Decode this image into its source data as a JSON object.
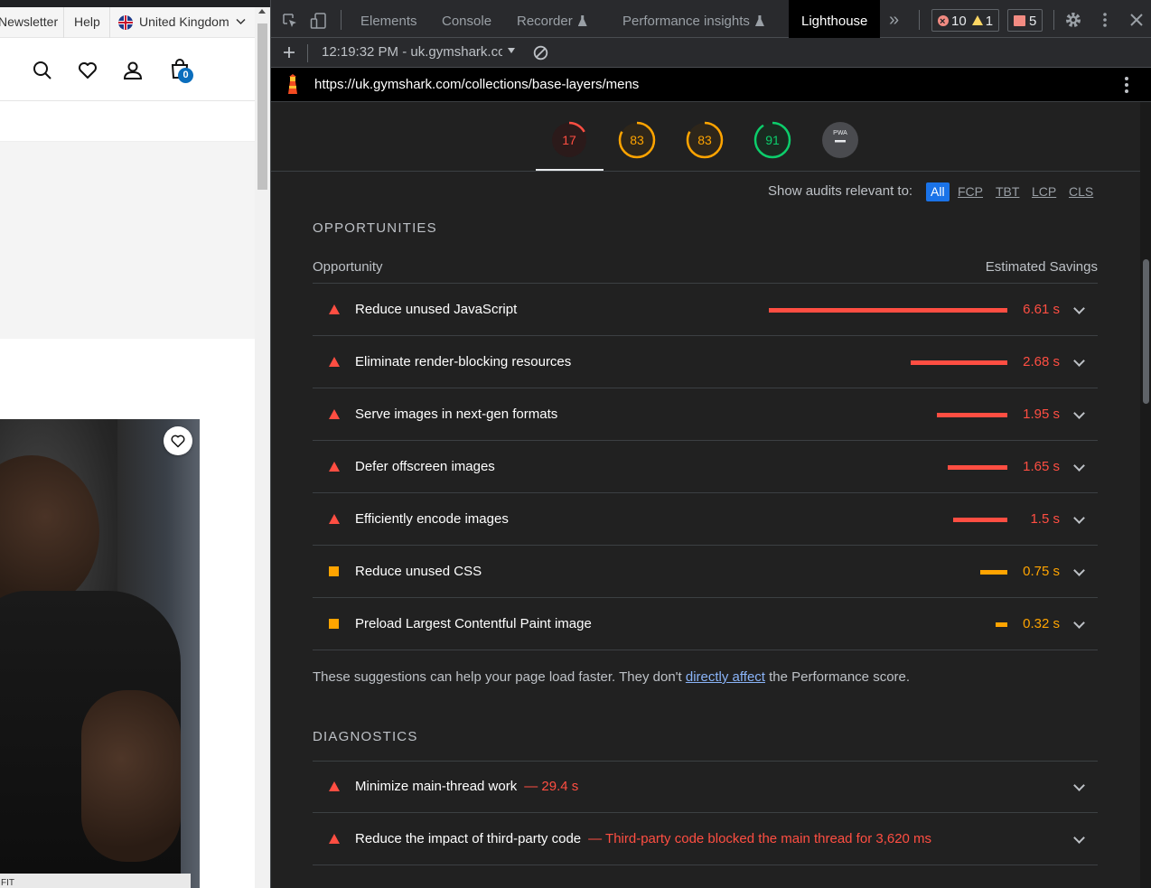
{
  "website": {
    "topbar": {
      "newsletter": "Newsletter",
      "help": "Help",
      "region": "United Kingdom"
    },
    "cart_count": "0",
    "product_tag": "FIT"
  },
  "devtools": {
    "tabs": [
      "Elements",
      "Console",
      "Recorder",
      "Performance insights",
      "Lighthouse"
    ],
    "active_tab": "Lighthouse",
    "more_tabs": "»",
    "errors": "10",
    "warnings": "1",
    "issues": "5",
    "report_selector": "12:19:32 PM - uk.gymshark.coi",
    "url": "https://uk.gymshark.com/collections/base-layers/mens"
  },
  "lighthouse": {
    "scores": [
      {
        "label": "17",
        "value": 17,
        "color": "#ff4e42"
      },
      {
        "label": "83",
        "value": 83,
        "color": "#ffa400"
      },
      {
        "label": "83",
        "value": 83,
        "color": "#ffa400"
      },
      {
        "label": "91",
        "value": 91,
        "color": "#0cce6b"
      },
      {
        "label": "PWA",
        "value": null,
        "color": "#9aa0a6"
      }
    ],
    "filter_label": "Show audits relevant to:",
    "filters": [
      "All",
      "FCP",
      "TBT",
      "LCP",
      "CLS"
    ],
    "opportunities": {
      "title": "OPPORTUNITIES",
      "col_left": "Opportunity",
      "col_right": "Estimated Savings",
      "items": [
        {
          "title": "Reduce unused JavaScript",
          "savings": "6.61 s",
          "value": 6.61,
          "status": "fail"
        },
        {
          "title": "Eliminate render-blocking resources",
          "savings": "2.68 s",
          "value": 2.68,
          "status": "fail"
        },
        {
          "title": "Serve images in next-gen formats",
          "savings": "1.95 s",
          "value": 1.95,
          "status": "fail"
        },
        {
          "title": "Defer offscreen images",
          "savings": "1.65 s",
          "value": 1.65,
          "status": "fail"
        },
        {
          "title": "Efficiently encode images",
          "savings": "1.5 s",
          "value": 1.5,
          "status": "fail"
        },
        {
          "title": "Reduce unused CSS",
          "savings": "0.75 s",
          "value": 0.75,
          "status": "average"
        },
        {
          "title": "Preload Largest Contentful Paint image",
          "savings": "0.32 s",
          "value": 0.32,
          "status": "average"
        }
      ],
      "note_before": "These suggestions can help your page load faster. They don't ",
      "note_link": "directly affect",
      "note_after": " the Performance score."
    },
    "diagnostics": {
      "title": "DIAGNOSTICS",
      "items": [
        {
          "title": "Minimize main-thread work",
          "display": "— 29.4 s"
        },
        {
          "title": "Reduce the impact of third-party code",
          "display": "— Third-party code blocked the main thread for 3,620 ms"
        }
      ]
    }
  }
}
